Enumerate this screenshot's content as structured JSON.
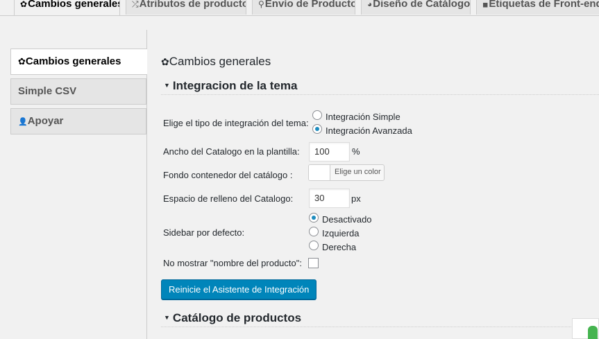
{
  "top_tabs": [
    {
      "icon": "gear-icon",
      "glyph": "✿",
      "label": "Cambios generales",
      "active": true
    },
    {
      "icon": "shuffle-icon",
      "glyph": "⤮",
      "label": "Atributos de producto",
      "active": false
    },
    {
      "icon": "map-pin-icon",
      "glyph": "⚲",
      "label": "Envío de Producto",
      "active": false
    },
    {
      "icon": "palette-icon",
      "glyph": "◕",
      "label": "Diseño de Catálogo",
      "active": false
    },
    {
      "icon": "comment-icon",
      "glyph": "◼",
      "label": "Etiquetas de Front-end",
      "active": false
    }
  ],
  "side_nav": [
    {
      "icon": "gear-icon",
      "glyph": "✿",
      "label": "Cambios generales",
      "active": true
    },
    {
      "icon": "",
      "glyph": "",
      "label": "Simple CSV",
      "active": false
    },
    {
      "icon": "person-icon",
      "glyph": "👤",
      "label": "Apoyar",
      "active": false
    }
  ],
  "content": {
    "heading_icon": "✿",
    "heading": "Cambios generales",
    "section1": "Integracion de la tema",
    "integration_type": {
      "label": "Elige el tipo de integración del tema:",
      "options": [
        "Integración Simple",
        "Integración Avanzada"
      ],
      "selected": "Integración Avanzada"
    },
    "catalog_width": {
      "label": "Ancho del Catalogo en la plantilla:",
      "value": "100",
      "unit": "%"
    },
    "container_bg": {
      "label": "Fondo contenedor del catálogo :",
      "button": "Elige un color",
      "color": "#ffffff"
    },
    "padding": {
      "label": "Espacio de relleno del Catalogo:",
      "value": "30",
      "unit": "px"
    },
    "sidebar_default": {
      "label": "Sidebar por defecto:",
      "options": [
        "Desactivado",
        "Izquierda",
        "Derecha"
      ],
      "selected": "Desactivado"
    },
    "hide_product_name": {
      "label": "No mostrar \"nombre del producto\":",
      "checked": false
    },
    "reset_button": "Reinicie el Asistente de Integración",
    "section2": "Catálogo de productos"
  },
  "colors": {
    "accent": "#0085ba",
    "radio_dot": "#1e8cbe",
    "background": "#f1f1f1"
  }
}
